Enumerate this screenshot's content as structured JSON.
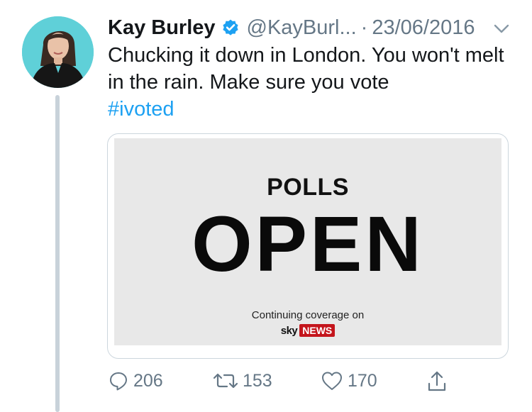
{
  "tweet": {
    "author_name": "Kay Burley",
    "handle": "@KayBurl...",
    "separator": "·",
    "date": "23/06/2016",
    "text": "Chucking it down in London. You won't melt in the rain. Make sure you vote",
    "hashtag": "#ivoted",
    "icons": {
      "verified": "verified-badge-icon",
      "menu": "chevron-down-icon",
      "reply": "reply-icon",
      "retweet": "retweet-icon",
      "like": "heart-icon",
      "share": "share-icon"
    }
  },
  "media": {
    "headline_small": "POLLS",
    "headline_large": "OPEN",
    "coverage_text": "Continuing coverage on",
    "brand_sky": "sky",
    "brand_news": "NEWS"
  },
  "actions": {
    "reply_count": "206",
    "retweet_count": "153",
    "like_count": "170"
  },
  "colors": {
    "link": "#1da1f2",
    "muted": "#657786",
    "verified": "#1da1f2",
    "thread_line": "#c8d2da",
    "avatar_bg": "#5fd0d8",
    "brand_red": "#c4151c"
  }
}
